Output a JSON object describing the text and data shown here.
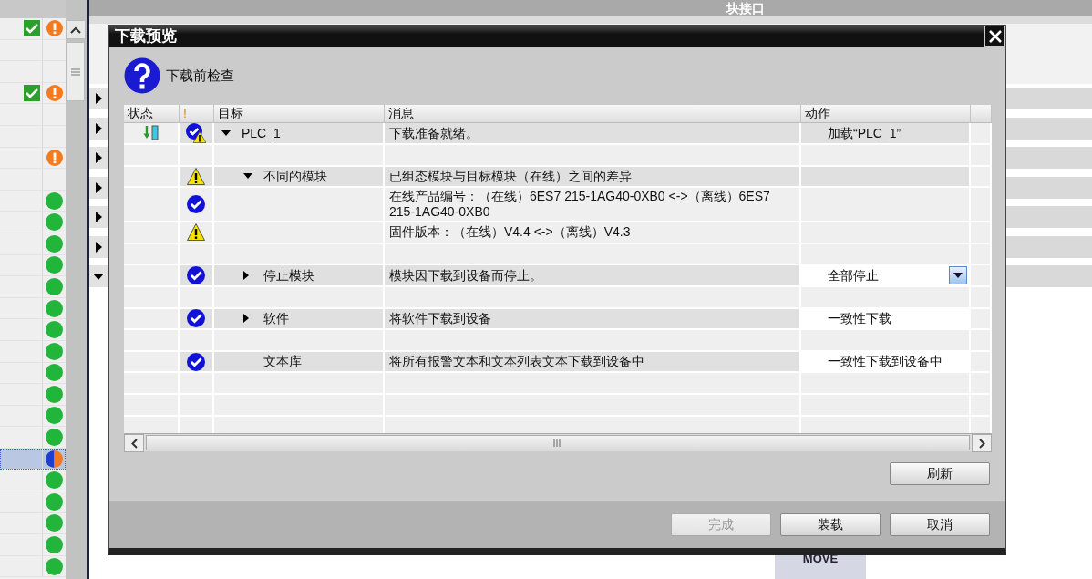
{
  "status_list": {
    "rows": [
      {
        "selected": false,
        "consistent": true,
        "kind": "warning"
      },
      {
        "selected": false,
        "consistent": false,
        "kind": "blank"
      },
      {
        "selected": false,
        "consistent": false,
        "kind": "blank"
      },
      {
        "selected": false,
        "consistent": true,
        "kind": "warning"
      },
      {
        "selected": false,
        "consistent": false,
        "kind": "blank"
      },
      {
        "selected": false,
        "consistent": false,
        "kind": "blank"
      },
      {
        "selected": false,
        "consistent": false,
        "kind": "warning"
      },
      {
        "selected": false,
        "consistent": false,
        "kind": "blank"
      },
      {
        "selected": false,
        "consistent": false,
        "kind": "ok"
      },
      {
        "selected": false,
        "consistent": false,
        "kind": "ok"
      },
      {
        "selected": false,
        "consistent": false,
        "kind": "ok"
      },
      {
        "selected": false,
        "consistent": false,
        "kind": "ok"
      },
      {
        "selected": false,
        "consistent": false,
        "kind": "ok"
      },
      {
        "selected": false,
        "consistent": false,
        "kind": "ok"
      },
      {
        "selected": false,
        "consistent": false,
        "kind": "ok"
      },
      {
        "selected": false,
        "consistent": false,
        "kind": "ok"
      },
      {
        "selected": false,
        "consistent": false,
        "kind": "ok"
      },
      {
        "selected": false,
        "consistent": false,
        "kind": "ok"
      },
      {
        "selected": false,
        "consistent": false,
        "kind": "ok"
      },
      {
        "selected": false,
        "consistent": false,
        "kind": "ok"
      },
      {
        "selected": true,
        "consistent": false,
        "kind": "mixed"
      },
      {
        "selected": false,
        "consistent": false,
        "kind": "ok"
      },
      {
        "selected": false,
        "consistent": false,
        "kind": "ok"
      },
      {
        "selected": false,
        "consistent": false,
        "kind": "ok"
      },
      {
        "selected": false,
        "consistent": false,
        "kind": "ok"
      },
      {
        "selected": false,
        "consistent": false,
        "kind": "ok"
      }
    ]
  },
  "editor": {
    "header": "块接口",
    "networks": [
      {
        "expanded": false
      },
      {
        "expanded": false
      },
      {
        "expanded": false
      },
      {
        "expanded": false
      },
      {
        "expanded": false
      },
      {
        "expanded": false
      },
      {
        "expanded": true
      }
    ],
    "block": {
      "title": "MOVE"
    }
  },
  "dialog": {
    "title": "下载预览",
    "heading": "下载前检查",
    "table": {
      "columns": [
        "状态",
        "!",
        "目标",
        "消息",
        "动作"
      ],
      "rows": [
        {
          "kind": "check_warning",
          "downloadable": true,
          "target": "PLC_1",
          "expanded": true,
          "message": "下载准备就绪。",
          "action": {
            "text": "加载“PLC_1”",
            "editable": false,
            "dropdown": false
          },
          "blank_after": true,
          "children": [
            {
              "kind": "warning",
              "downloadable": false,
              "target": "不同的模块",
              "expanded": true,
              "message": "已组态模块与目标模块（在线）之间的差异",
              "blank_after": false,
              "children": [
                {
                  "kind": "check",
                  "downloadable": false,
                  "message": "在线产品编号：（在线）6ES7 215-1AG40-0XB0 <->（离线）6ES7 215-1AG40-0XB0",
                  "blank_after": false
                },
                {
                  "kind": "warning",
                  "downloadable": false,
                  "message": "固件版本：（在线）V4.4 <->（离线）V4.3",
                  "blank_after": true
                }
              ]
            },
            {
              "kind": "check",
              "downloadable": false,
              "target": "停止模块",
              "expanded": false,
              "message": "模块因下载到设备而停止。",
              "action": {
                "text": "全部停止",
                "editable": true,
                "dropdown": true
              },
              "blank_after": true
            },
            {
              "kind": "check",
              "downloadable": false,
              "target": "软件",
              "expanded": false,
              "message": "将软件下载到设备",
              "action": {
                "text": "一致性下载",
                "editable": true,
                "dropdown": false
              },
              "blank_after": true
            },
            {
              "kind": "check",
              "downloadable": false,
              "target": "文本库",
              "message": "将所有报警文本和文本列表文本下载到设备中",
              "action": {
                "text": "一致性下载到设备中",
                "editable": true,
                "dropdown": false
              },
              "blank_after": false
            }
          ]
        }
      ]
    },
    "refresh_button": "刷新",
    "buttons": [
      {
        "label": "完成",
        "disabled": true
      },
      {
        "label": "装载",
        "disabled": false
      },
      {
        "label": "取消",
        "disabled": false
      }
    ]
  }
}
